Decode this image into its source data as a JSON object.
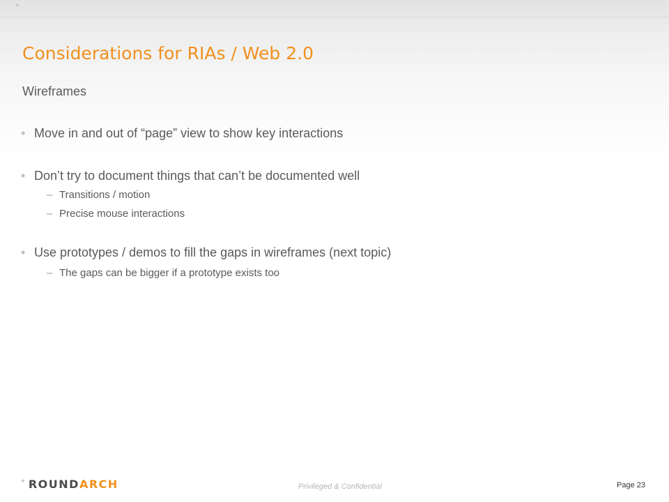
{
  "header": {
    "corner_mark": "+"
  },
  "title": "Considerations for RIAs / Web 2.0",
  "subtitle": "Wireframes",
  "bullets": [
    {
      "text": "Move in and out of “page” view to show key interactions",
      "subitems": []
    },
    {
      "text": "Don’t try to document things that can’t be documented well",
      "subitems": [
        "Transitions / motion",
        "Precise mouse interactions"
      ]
    },
    {
      "text": "Use prototypes / demos to fill the gaps in wireframes (next topic)",
      "subitems": [
        "The gaps can be bigger if a prototype exists too"
      ]
    }
  ],
  "bullet_glyph": "•",
  "dash_glyph": "–",
  "footer": {
    "logo_plus": "+",
    "logo_part1": "ROUND",
    "logo_part2": "ARCH",
    "confidential": "Privileged & Confidential",
    "page_label": "Page 23"
  },
  "colors": {
    "title": "#f0901e",
    "body_text": "#5a5a5a",
    "logo_accent": "#f0901e"
  }
}
